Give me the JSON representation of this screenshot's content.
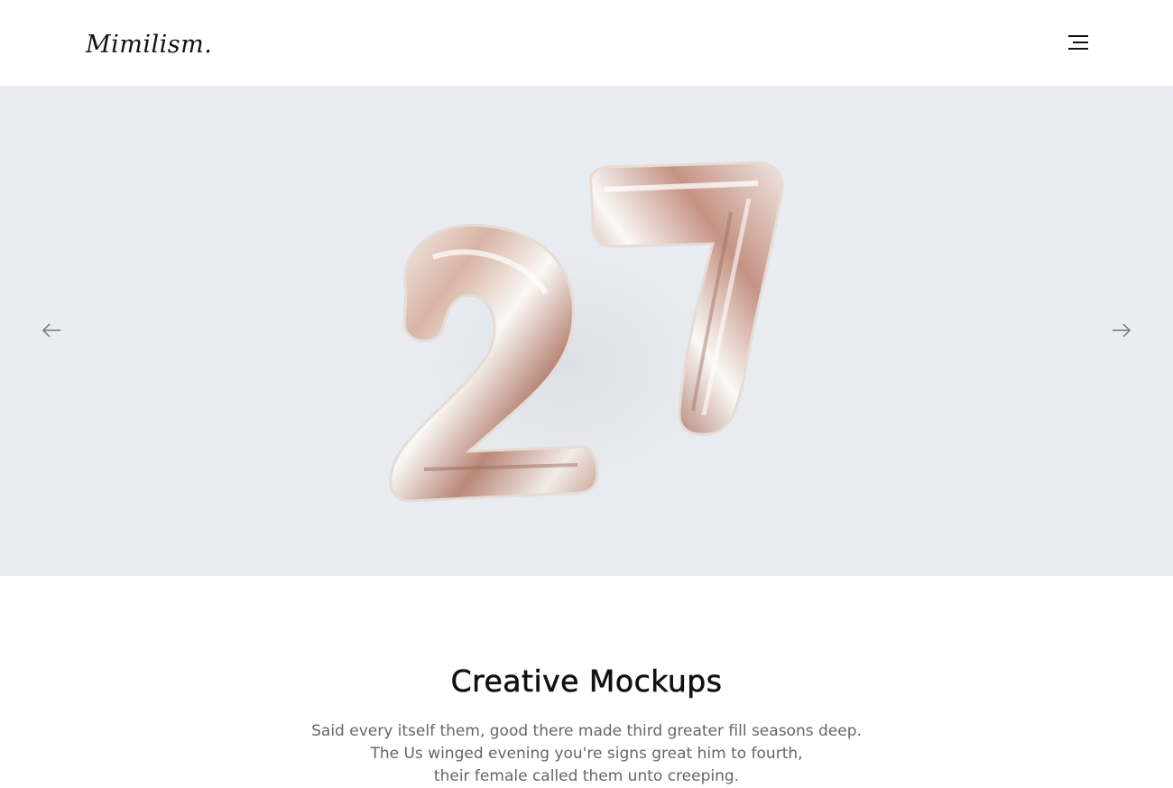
{
  "header": {
    "logo_text": "Mimilism.",
    "menu_icon": "hamburger-menu-icon"
  },
  "slider": {
    "background_color": "#e9ecf1",
    "image_subject": "27",
    "prev_icon": "arrow-left-icon",
    "next_icon": "arrow-right-icon"
  },
  "section": {
    "title": "Creative Mockups",
    "description_lines": [
      "Said every itself them, good there made third greater fill seasons deep.",
      "The Us winged evening you're signs great him to fourth,",
      "their female called them unto creeping."
    ]
  },
  "colors": {
    "text_primary": "#111111",
    "text_secondary": "#666666",
    "balloon_light": "#f4f1ef",
    "balloon_rose": "#c89a88"
  }
}
